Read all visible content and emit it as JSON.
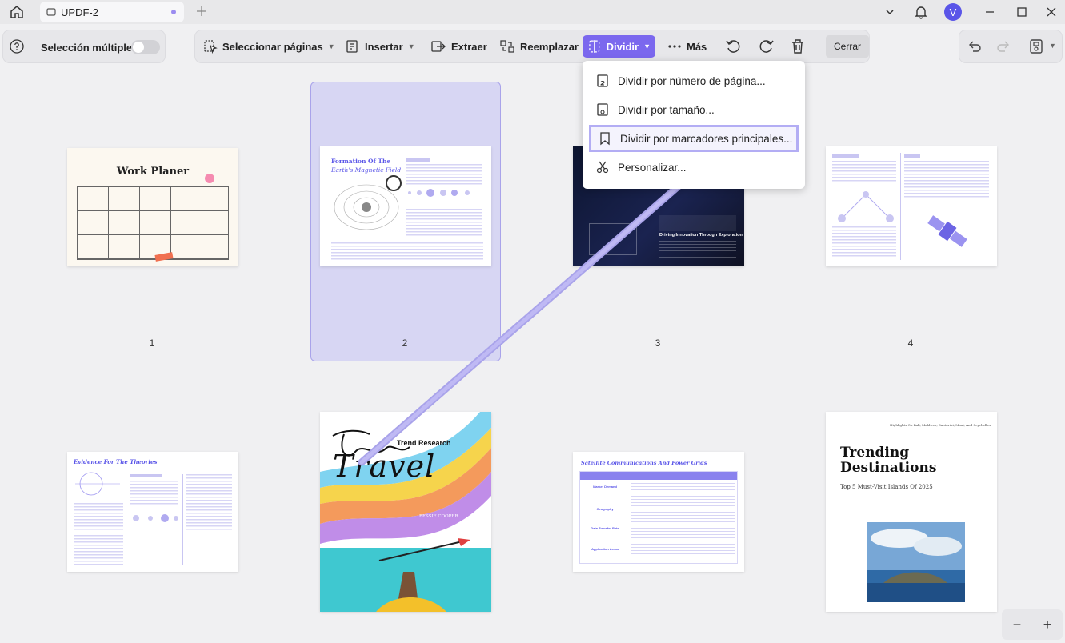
{
  "window": {
    "tab_title": "UPDF-2",
    "avatar_initial": "V"
  },
  "left_panel": {
    "multi_select_label": "Selección múltiple"
  },
  "toolbar": {
    "select_pages": "Seleccionar páginas",
    "insert": "Insertar",
    "extract": "Extraer",
    "replace": "Reemplazar",
    "split": "Dividir",
    "more": "Más",
    "close": "Cerrar"
  },
  "split_menu": {
    "items": [
      {
        "label": "Dividir por número de página..."
      },
      {
        "label": "Dividir por tamaño..."
      },
      {
        "label": "Dividir por marcadores principales..."
      },
      {
        "label": "Personalizar..."
      }
    ]
  },
  "pages": [
    {
      "number": "1",
      "title": "Work Planer"
    },
    {
      "number": "2",
      "title": "Formation Of The",
      "subtitle": "Earth's Magnetic Field"
    },
    {
      "number": "3",
      "caption": "Driving Innovation Through Exploration"
    },
    {
      "number": "4"
    },
    {
      "title": "Evidence For The Theories"
    },
    {
      "title": "Travel",
      "subtitle": "Trend Research",
      "author": "BESSIE COOPER"
    },
    {
      "title": "Satellite Communications And Power Grids",
      "rows": [
        "Market Demand",
        "Geography",
        "Data Transfer Rate",
        "Application Areas"
      ]
    },
    {
      "kicker": "Highlights On Bali, Maldives, Santorini, Maui, And Seychelles",
      "title": "Trending Destinations",
      "subtitle": "Top 5 Must-Visit Islands Of 2025"
    }
  ],
  "zoom": {
    "minus": "−",
    "plus": "+"
  },
  "colors": {
    "accent": "#7b68ee",
    "selection": "#d7d6f3"
  }
}
